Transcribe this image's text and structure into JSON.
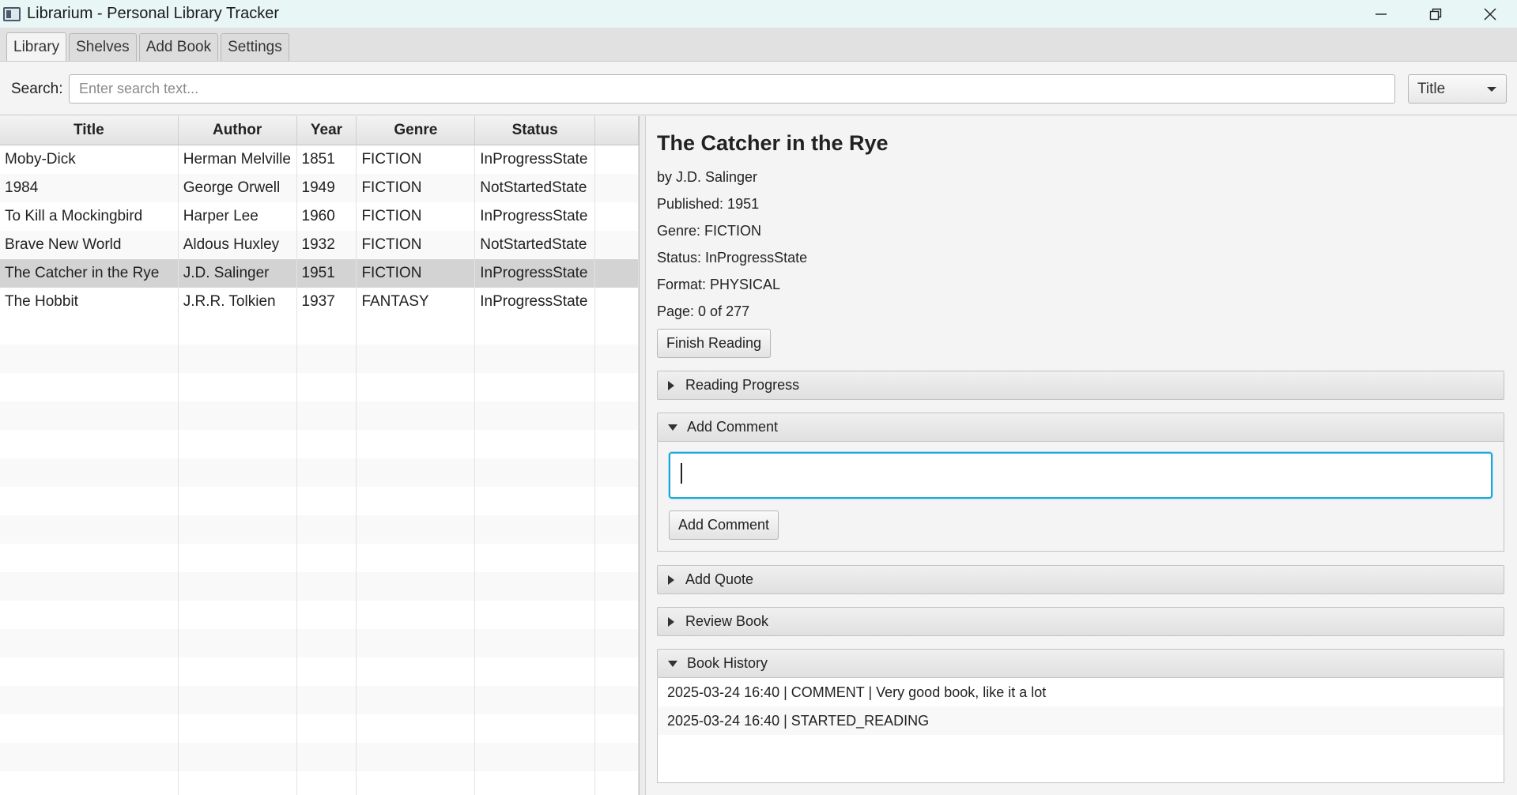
{
  "window": {
    "title": "Librarium - Personal Library Tracker"
  },
  "tabs": [
    {
      "label": "Library",
      "active": true
    },
    {
      "label": "Shelves"
    },
    {
      "label": "Add Book"
    },
    {
      "label": "Settings"
    }
  ],
  "search": {
    "label": "Search:",
    "placeholder": "Enter search text...",
    "value": "",
    "field_selected": "Title"
  },
  "table": {
    "columns": [
      "Title",
      "Author",
      "Year",
      "Genre",
      "Status"
    ],
    "rows": [
      {
        "title": "Moby-Dick",
        "author": "Herman Melville",
        "year": "1851",
        "genre": "FICTION",
        "status": "InProgressState"
      },
      {
        "title": "1984",
        "author": "George Orwell",
        "year": "1949",
        "genre": "FICTION",
        "status": "NotStartedState"
      },
      {
        "title": "To Kill a Mockingbird",
        "author": "Harper Lee",
        "year": "1960",
        "genre": "FICTION",
        "status": "InProgressState"
      },
      {
        "title": "Brave New World",
        "author": "Aldous Huxley",
        "year": "1932",
        "genre": "FICTION",
        "status": "NotStartedState"
      },
      {
        "title": "The Catcher in the Rye",
        "author": "J.D. Salinger",
        "year": "1951",
        "genre": "FICTION",
        "status": "InProgressState",
        "selected": true
      },
      {
        "title": "The Hobbit",
        "author": "J.R.R. Tolkien",
        "year": "1937",
        "genre": "FANTASY",
        "status": "InProgressState"
      }
    ]
  },
  "detail": {
    "title": "The Catcher in the Rye",
    "author_line": "by J.D. Salinger",
    "published_line": "Published: 1951",
    "genre_line": "Genre: FICTION",
    "status_line": "Status: InProgressState",
    "format_line": "Format: PHYSICAL",
    "page_line": "Page: 0 of 277",
    "finish_button": "Finish Reading",
    "sections": {
      "reading_progress": "Reading Progress",
      "add_comment": "Add Comment",
      "add_comment_button": "Add Comment",
      "add_quote": "Add Quote",
      "review_book": "Review Book",
      "book_history": "Book History"
    },
    "history": [
      "2025-03-24 16:40 | COMMENT | Very good book, like it a lot",
      "2025-03-24 16:40 | STARTED_READING"
    ]
  },
  "colors": {
    "titlebar_bg": "#e9f6f6",
    "selected_row": "#d3d3d3",
    "focus_border": "#1ea7d6"
  }
}
